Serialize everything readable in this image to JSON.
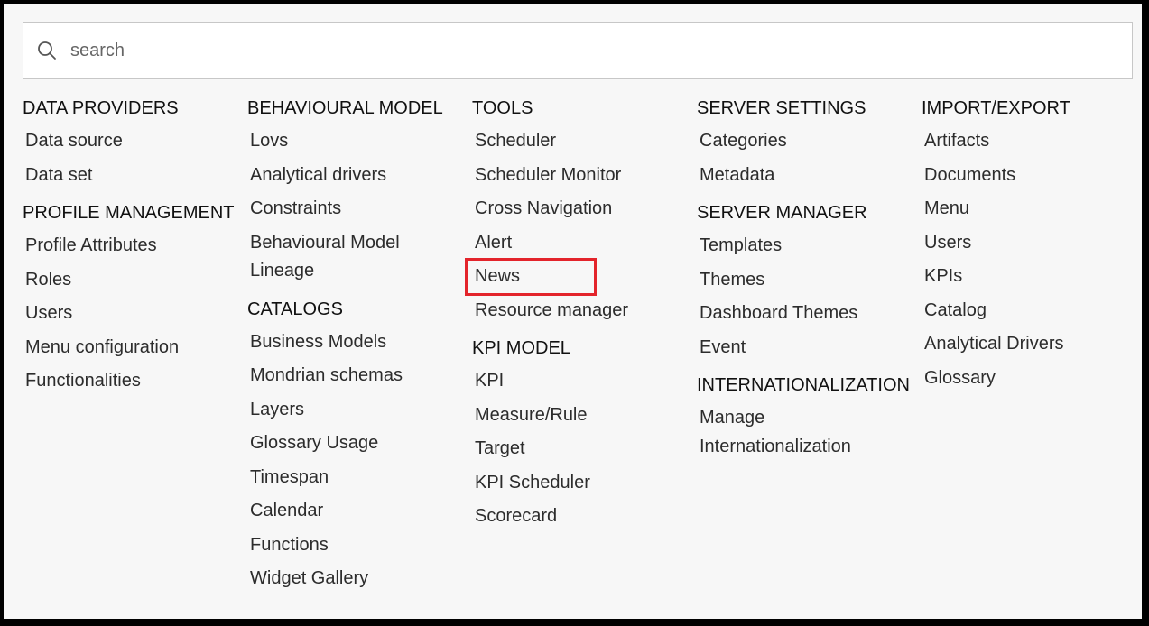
{
  "search": {
    "placeholder": "search"
  },
  "columns": [
    {
      "sections": [
        {
          "title": "DATA PROVIDERS",
          "items": [
            "Data source",
            "Data set"
          ]
        },
        {
          "title": "PROFILE MANAGEMENT",
          "items": [
            "Profile Attributes",
            "Roles",
            "Users",
            "Menu configuration",
            "Functionalities"
          ]
        }
      ]
    },
    {
      "sections": [
        {
          "title": "BEHAVIOURAL MODEL",
          "items": [
            "Lovs",
            "Analytical drivers",
            "Constraints",
            "Behavioural Model Lineage"
          ]
        },
        {
          "title": "CATALOGS",
          "items": [
            "Business Models",
            "Mondrian schemas",
            "Layers",
            "Glossary Usage",
            "Timespan",
            "Calendar",
            "Functions",
            "Widget Gallery"
          ]
        }
      ]
    },
    {
      "sections": [
        {
          "title": "TOOLS",
          "items": [
            "Scheduler",
            "Scheduler Monitor",
            "Cross Navigation",
            "Alert",
            "News",
            "Resource manager"
          ]
        },
        {
          "title": "KPI MODEL",
          "items": [
            "KPI",
            "Measure/Rule",
            "Target",
            "KPI Scheduler",
            "Scorecard"
          ]
        }
      ]
    },
    {
      "sections": [
        {
          "title": "SERVER SETTINGS",
          "items": [
            "Categories",
            "Metadata"
          ]
        },
        {
          "title": "SERVER MANAGER",
          "items": [
            "Templates",
            "Themes",
            "Dashboard Themes",
            "Event"
          ]
        },
        {
          "title": "INTERNATIONALIZATION",
          "items": [
            "Manage Internationalization"
          ]
        }
      ]
    },
    {
      "sections": [
        {
          "title": "IMPORT/EXPORT",
          "items": [
            "Artifacts",
            "Documents",
            "Menu",
            "Users",
            "KPIs",
            "Catalog",
            "Analytical Drivers",
            "Glossary"
          ]
        }
      ]
    }
  ],
  "highlight": {
    "item": "News",
    "color": "#e3242b"
  }
}
